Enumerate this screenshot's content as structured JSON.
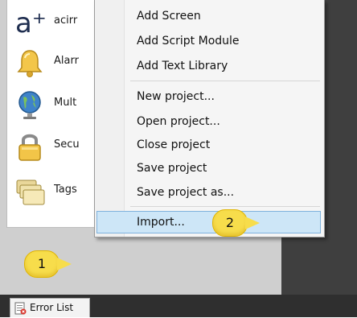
{
  "components": [
    {
      "label": "acirr",
      "icon": "acirrus-logo-icon"
    },
    {
      "label": "Alarr",
      "icon": "bell-icon"
    },
    {
      "label": "Mult",
      "icon": "globe-icon"
    },
    {
      "label": "Secu",
      "icon": "padlock-icon"
    },
    {
      "label": "Tags",
      "icon": "tags-folder-icon"
    }
  ],
  "logo_text": "a⁺",
  "context_menu": {
    "items": [
      {
        "label": "Add Screen"
      },
      {
        "label": "Add Script Module"
      },
      {
        "label": "Add Text Library"
      },
      {
        "label": "New project..."
      },
      {
        "label": "Open project..."
      },
      {
        "label": "Close project"
      },
      {
        "label": "Save project"
      },
      {
        "label": "Save project as..."
      },
      {
        "label": "Import...",
        "highlighted": true
      }
    ]
  },
  "callouts": [
    {
      "number": "1"
    },
    {
      "number": "2"
    }
  ],
  "bottom_tab": {
    "label": "Error List",
    "icon": "error-list-icon"
  },
  "colors": {
    "highlight_bg": "#cde6f7",
    "highlight_border": "#7fb2dd",
    "callout_yellow": "#f7dd4b",
    "dark_bg": "#3f3f3f"
  }
}
